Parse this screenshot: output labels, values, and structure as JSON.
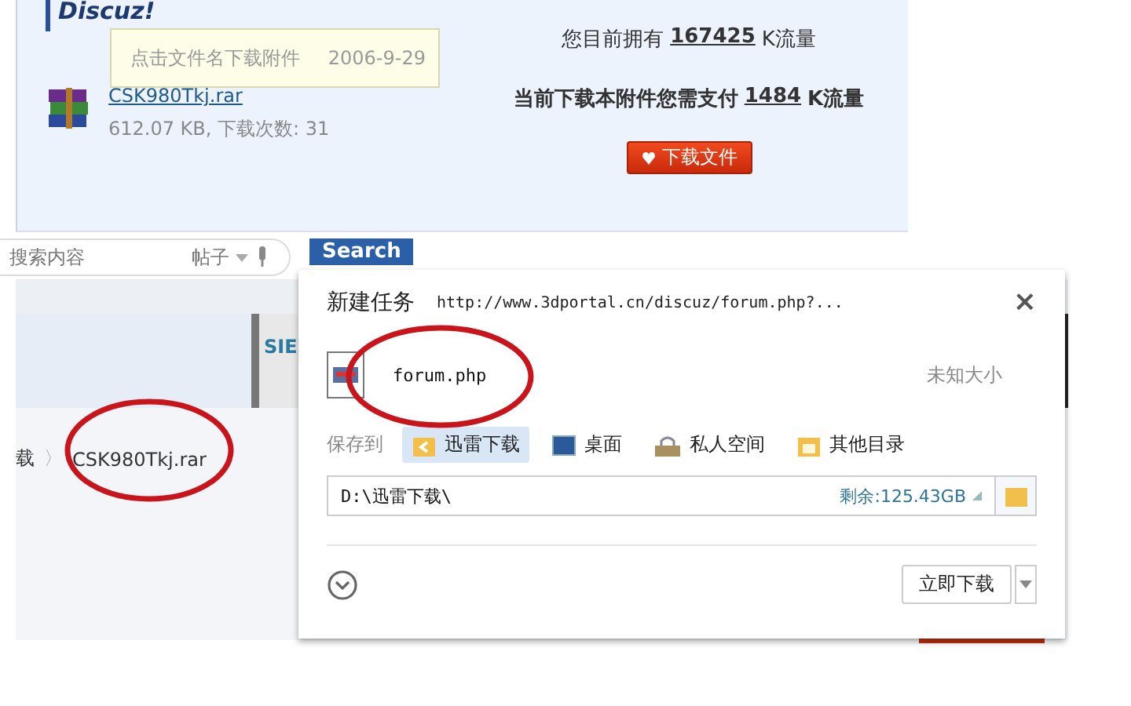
{
  "attachment_panel": {
    "logo": "Discuz!",
    "tooltip": {
      "text": "点击文件名下载附件",
      "date": "2006-9-29"
    },
    "file": {
      "name": "CSK980Tkj.rar",
      "info": "612.07 KB, 下载次数: 31"
    },
    "balance": {
      "label": "您目前拥有",
      "amount": "167425",
      "unit": "K流量"
    },
    "cost": {
      "label": "当前下载本附件您需支付",
      "amount": "1484",
      "unit": "K流量"
    },
    "download_button": "下载文件"
  },
  "page": {
    "search": {
      "placeholder": "搜索内容",
      "scope": "帖子",
      "button": "Search"
    },
    "ad_text": "SIE",
    "breadcrumb": {
      "prefix": "载",
      "separator": "〉",
      "current": "CSK980Tkj.rar"
    }
  },
  "dialog": {
    "title": "新建任务",
    "url": "http://www.3dportal.cn/discuz/forum.php?...",
    "close": "×",
    "file": {
      "name": "forum.php",
      "size": "未知大小"
    },
    "save_label": "保存到",
    "locations": [
      {
        "label": "迅雷下载",
        "kind": "thunder",
        "selected": true
      },
      {
        "label": "桌面",
        "kind": "desktop",
        "selected": false
      },
      {
        "label": "私人空间",
        "kind": "private",
        "selected": false
      },
      {
        "label": "其他目录",
        "kind": "folder",
        "selected": false
      }
    ],
    "path": "D:\\迅雷下载\\",
    "free_space": "剩余:125.43GB",
    "download_button": "立即下载"
  }
}
